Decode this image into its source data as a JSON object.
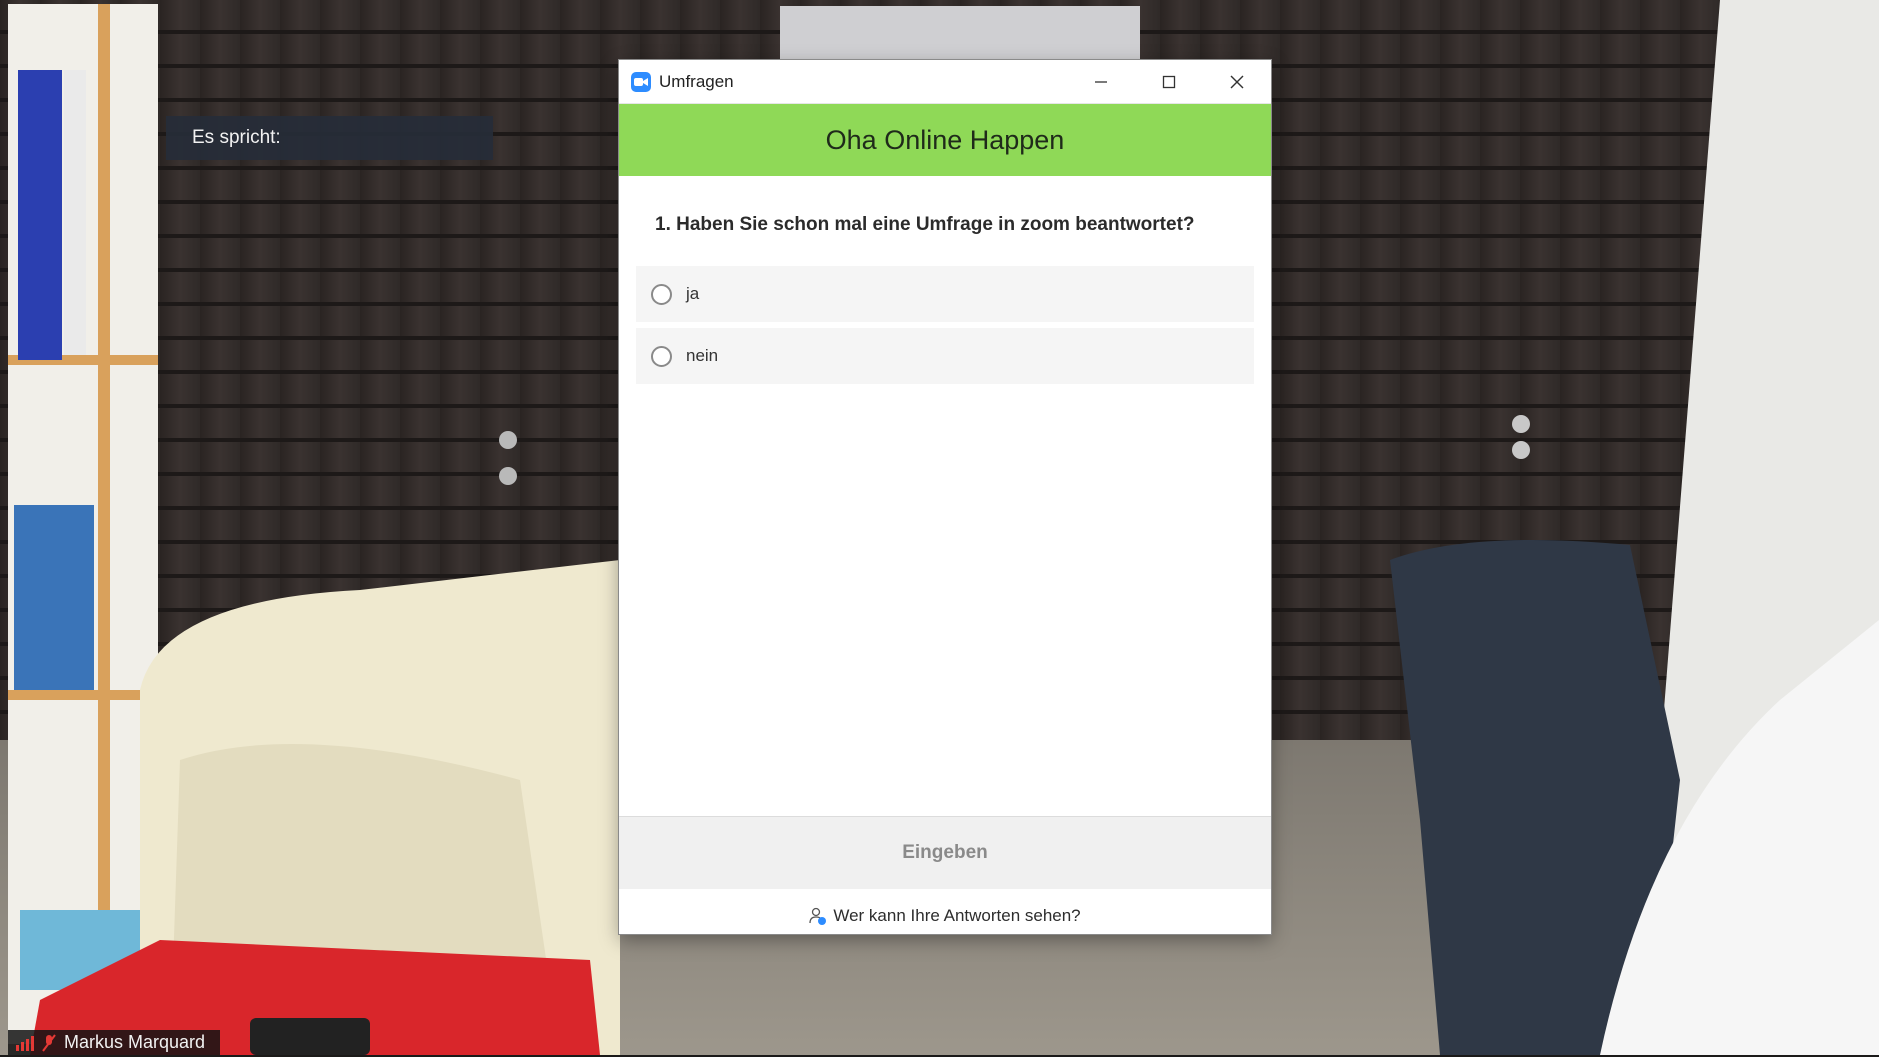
{
  "window": {
    "title": "Umfragen",
    "icon": "zoom-video-icon",
    "controls": [
      "minimize-icon",
      "maximize-icon",
      "close-icon"
    ]
  },
  "poll": {
    "header_title": "Oha Online Happen",
    "question": "1. Haben Sie schon mal eine Umfrage in zoom beantwortet?",
    "options": [
      {
        "label": "ja",
        "selected": false
      },
      {
        "label": "nein",
        "selected": false
      }
    ],
    "submit_label": "Eingeben",
    "visibility_link": "Wer kann Ihre Antworten sehen?",
    "visibility_icon": "person-info-icon"
  },
  "meeting": {
    "speaker_label": "Es spricht:",
    "participant_name": "Markus Marquard",
    "participant_icons": [
      "signal-bars-icon",
      "mic-muted-icon"
    ]
  },
  "colors": {
    "header_green": "#8fd957",
    "zoom_blue": "#2d8cff",
    "submit_disabled_text": "#8a8a8a",
    "muted_red": "#e53935"
  }
}
